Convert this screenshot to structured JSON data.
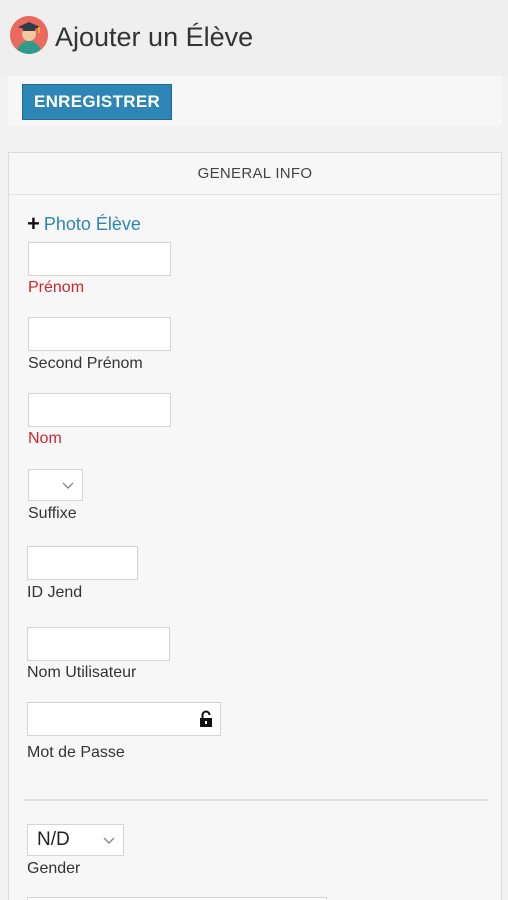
{
  "header": {
    "title": "Ajouter un Élève",
    "avatar_icon": "student-graduate-icon"
  },
  "toolbar": {
    "save_label": "ENREGISTRER"
  },
  "panel": {
    "tab_label": "GENERAL INFO",
    "photo_link": "Photo Élève",
    "fields": {
      "first_name": {
        "label": "Prénom",
        "value": "",
        "required": true
      },
      "middle_name": {
        "label": "Second Prénom",
        "value": ""
      },
      "last_name": {
        "label": "Nom",
        "value": "",
        "required": true
      },
      "suffix": {
        "label": "Suffixe",
        "value": ""
      },
      "id": {
        "label": "ID Jend",
        "value": ""
      },
      "username": {
        "label": "Nom Utilisateur",
        "value": ""
      },
      "password": {
        "label": "Mot de Passe",
        "value": ""
      },
      "gender": {
        "label": "Gender",
        "value": "N/D"
      }
    }
  },
  "colors": {
    "accent": "#2d86b5",
    "required": "#d0262e"
  }
}
